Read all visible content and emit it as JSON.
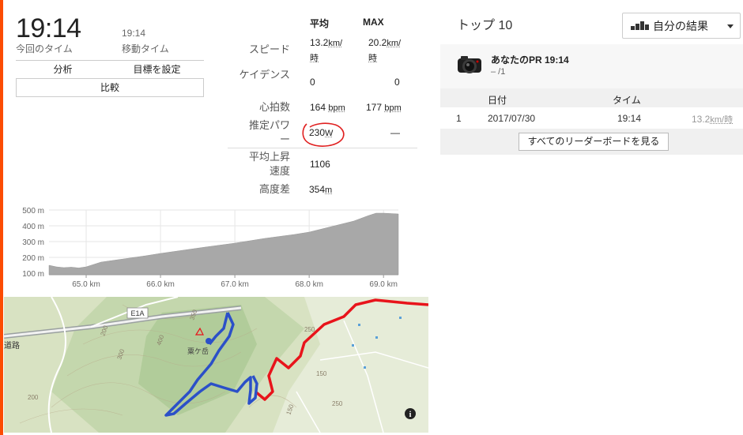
{
  "summary": {
    "time": "19:14",
    "time_label": "今回のタイム",
    "moving_time": "19:14",
    "moving_time_label": "移動タイム",
    "analyze_label": "分析",
    "goal_label": "目標を設定",
    "compare_label": "比較"
  },
  "stats": {
    "avg_header": "平均",
    "max_header": "MAX",
    "rows": [
      {
        "label": "スピード",
        "avg": "13.2",
        "avg_unit": "km/時",
        "max": "20.2",
        "max_unit": "km/時"
      },
      {
        "label": "ケイデンス",
        "avg": "0",
        "max": "0"
      },
      {
        "label": "心拍数",
        "avg": "164",
        "avg_unit": "bpm",
        "max": "177",
        "max_unit": "bpm"
      },
      {
        "label": "推定パワー",
        "avg": "230",
        "avg_unit": "W",
        "max": "—"
      },
      {
        "label": "平均上昇速度",
        "avg": "1106"
      },
      {
        "label": "高度差",
        "avg": "354",
        "avg_unit": "m"
      }
    ]
  },
  "chart_data": {
    "type": "area",
    "x": [
      64.5,
      64.6,
      64.7,
      64.8,
      64.9,
      65.0,
      65.2,
      65.5,
      65.8,
      66.0,
      66.3,
      66.6,
      67.0,
      67.4,
      67.8,
      68.0,
      68.3,
      68.6,
      68.8,
      68.9,
      69.0,
      69.2
    ],
    "y": [
      150,
      140,
      135,
      138,
      133,
      140,
      170,
      190,
      210,
      225,
      245,
      265,
      290,
      320,
      345,
      360,
      395,
      430,
      465,
      480,
      480,
      475
    ],
    "xlim": [
      64.5,
      69.2
    ],
    "ylim": [
      90,
      500
    ],
    "y_ticks": [
      "500 m",
      "400 m",
      "300 m",
      "200 m",
      "100 m"
    ],
    "y_tick_values": [
      500,
      400,
      300,
      200,
      100
    ],
    "x_ticks": [
      "65.0 km",
      "66.0 km",
      "67.0 km",
      "68.0 km",
      "69.0 km"
    ],
    "x_tick_values": [
      65.0,
      66.0,
      67.0,
      68.0,
      69.0
    ],
    "grid": true,
    "fill_color": "#a8a8a8"
  },
  "map": {
    "road_label": "E1A",
    "place_label": "粟ケ岳",
    "road_fragment": "道路",
    "contours": [
      "250",
      "200",
      "300",
      "400",
      "350",
      "150",
      "250",
      "200",
      "150"
    ],
    "info_icon": "i"
  },
  "leaderboard": {
    "title": "トップ 10",
    "filter_label": "自分の結果",
    "pr_title": "あなたのPR 19:14",
    "pr_sub": "– /1",
    "col_date": "日付",
    "col_time": "タイム",
    "rows": [
      {
        "rank": "1",
        "date": "2017/07/30",
        "time": "19:14",
        "speed": "13.2",
        "speed_unit": "km/時"
      }
    ],
    "view_all": "すべてのリーダーボードを見る"
  },
  "colors": {
    "accent": "#fc4c02",
    "route_blue": "#2b50c8",
    "route_red": "#e8141b",
    "annotation_red": "#e02020"
  }
}
